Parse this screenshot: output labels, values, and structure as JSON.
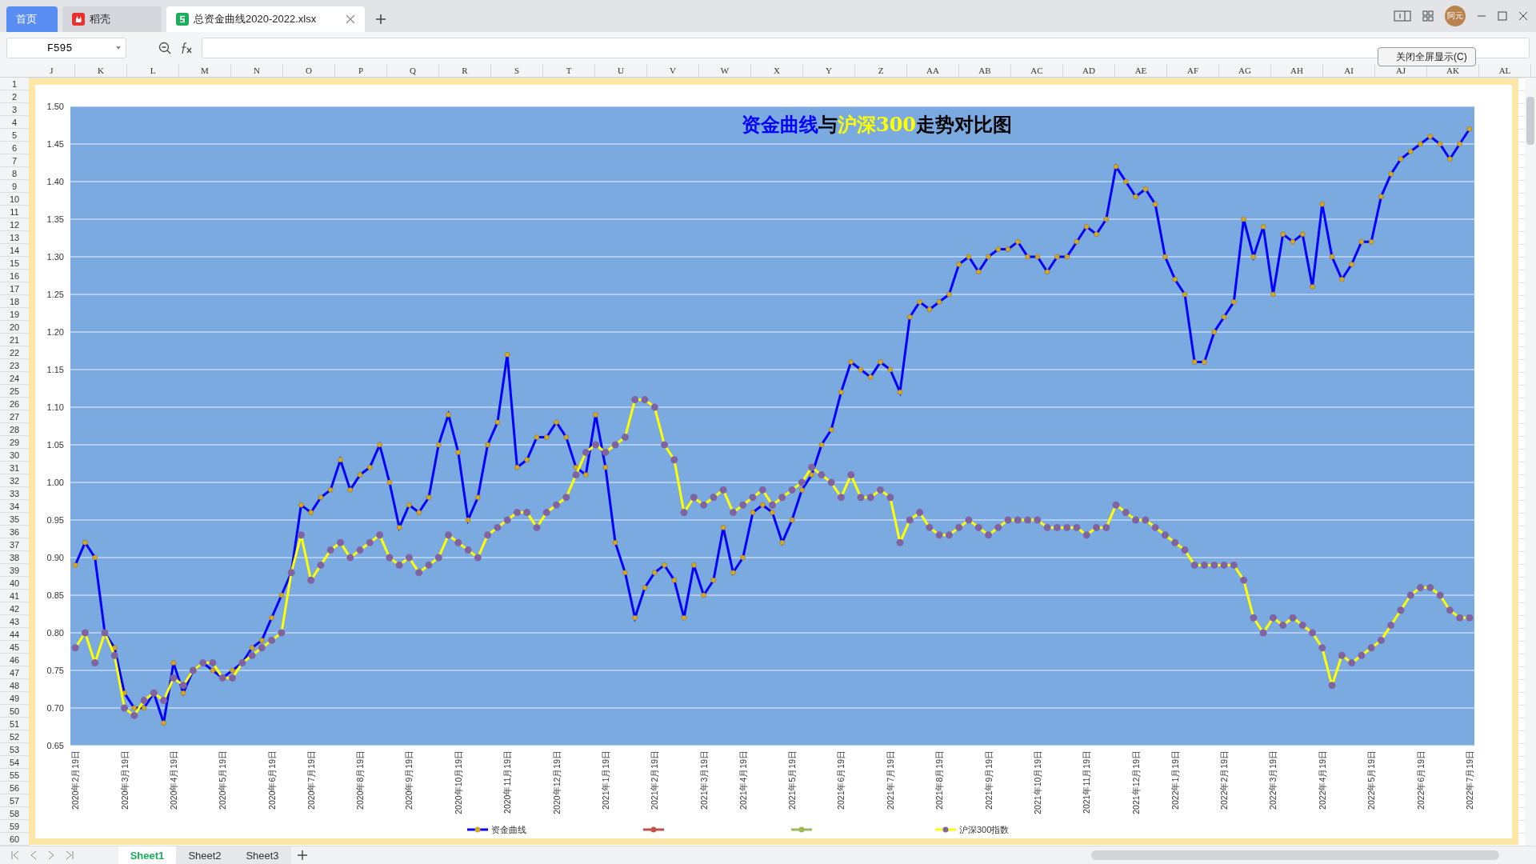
{
  "tabs": [
    {
      "label": "首页",
      "kind": "home",
      "selected": false
    },
    {
      "label": "稻壳",
      "kind": "docer",
      "selected": false
    },
    {
      "label": "总资金曲线2020-2022.xlsx",
      "kind": "sheet",
      "selected": true
    }
  ],
  "user": {
    "avatar_text": "阿元"
  },
  "formula_bar": {
    "cell_ref": "F595"
  },
  "columns": [
    "J",
    "K",
    "L",
    "M",
    "N",
    "O",
    "P",
    "Q",
    "R",
    "S",
    "T",
    "U",
    "V",
    "W",
    "X",
    "Y",
    "Z",
    "AA",
    "AB",
    "AC",
    "AD",
    "AE",
    "AF",
    "AG",
    "AH",
    "AI",
    "AJ",
    "AK",
    "AL"
  ],
  "rows": [
    "1",
    "2",
    "3",
    "4",
    "5",
    "6",
    "7",
    "8",
    "9",
    "10",
    "11",
    "12",
    "13",
    "14",
    "15",
    "16",
    "17",
    "18",
    "19",
    "20",
    "21",
    "22",
    "23",
    "24",
    "25",
    "26",
    "27",
    "28",
    "29",
    "30",
    "31",
    "32",
    "33",
    "34",
    "35",
    "36",
    "37",
    "38",
    "39",
    "40",
    "41",
    "42",
    "43",
    "44",
    "45",
    "46",
    "47",
    "48",
    "49",
    "50",
    "51",
    "52",
    "53",
    "54",
    "55",
    "56",
    "57",
    "58",
    "59",
    "60"
  ],
  "fullscreen_button": "关闭全屏显示(C)",
  "chart": {
    "title_parts": [
      {
        "text": "资金曲线",
        "color": "#0000ff"
      },
      {
        "text": "与",
        "color": "#000000"
      },
      {
        "text": "沪深300",
        "color": "#ffff00"
      },
      {
        "text": "走势对比图",
        "color": "#000000"
      }
    ],
    "chart_data": {
      "type": "line",
      "ylim": [
        0.65,
        1.5
      ],
      "grid": true,
      "legend": true,
      "categories": [
        "2020年2月19日",
        null,
        null,
        null,
        null,
        "2020年3月19日",
        null,
        null,
        null,
        null,
        "2020年4月19日",
        null,
        null,
        null,
        null,
        "2020年5月19日",
        null,
        null,
        null,
        null,
        "2020年6月19日",
        null,
        null,
        null,
        "2020年7月19日",
        null,
        null,
        null,
        null,
        "2020年8月19日",
        null,
        null,
        null,
        null,
        "2020年9月19日",
        null,
        null,
        null,
        null,
        "2020年10月19日",
        null,
        null,
        null,
        null,
        "2020年11月19日",
        null,
        null,
        null,
        null,
        "2020年12月19日",
        null,
        null,
        null,
        null,
        "2021年1月19日",
        null,
        null,
        null,
        null,
        "2021年2月19日",
        null,
        null,
        null,
        null,
        "2021年3月19日",
        null,
        null,
        null,
        "2021年4月19日",
        null,
        null,
        null,
        null,
        "2021年5月19日",
        null,
        null,
        null,
        null,
        "2021年6月19日",
        null,
        null,
        null,
        null,
        "2021年7月19日",
        null,
        null,
        null,
        null,
        "2021年8月19日",
        null,
        null,
        null,
        null,
        "2021年9月19日",
        null,
        null,
        null,
        null,
        "2021年10月19日",
        null,
        null,
        null,
        null,
        "2021年11月19日",
        null,
        null,
        null,
        null,
        "2021年12月19日",
        null,
        null,
        null,
        "2022年1月19日",
        null,
        null,
        null,
        null,
        "2022年2月19日",
        null,
        null,
        null,
        null,
        "2022年3月19日",
        null,
        null,
        null,
        null,
        "2022年4月19日",
        null,
        null,
        null,
        null,
        "2022年5月19日",
        null,
        null,
        null,
        null,
        "2022年6月19日",
        null,
        null,
        null,
        null,
        "2022年7月19日"
      ],
      "yticks": [
        {
          "value": 0.65,
          "label": "0.65"
        },
        {
          "value": 0.7,
          "label": "0.70"
        },
        {
          "value": 0.75,
          "label": "0.75"
        },
        {
          "value": 0.8,
          "label": "0.80"
        },
        {
          "value": 0.85,
          "label": "0.85"
        },
        {
          "value": 0.9,
          "label": "0.90"
        },
        {
          "value": 0.95,
          "label": "0.95"
        },
        {
          "value": 1.0,
          "label": "1.00"
        },
        {
          "value": 1.05,
          "label": "1.05"
        },
        {
          "value": 1.1,
          "label": "1.10"
        },
        {
          "value": 1.15,
          "label": "1.15"
        },
        {
          "value": 1.2,
          "label": "1.20"
        },
        {
          "value": 1.25,
          "label": "1.25"
        },
        {
          "value": 1.3,
          "label": "1.30"
        },
        {
          "value": 1.35,
          "label": "1.35"
        },
        {
          "value": 1.4,
          "label": "1.40"
        },
        {
          "value": 1.45,
          "label": "1.45"
        },
        {
          "value": 1.5,
          "label": "1.50"
        }
      ],
      "series": [
        {
          "name": "资金曲线",
          "color": "#0000ff",
          "marker": {
            "shape": "circle",
            "color": "#d4a82a"
          },
          "values": [
            0.89,
            0.92,
            0.9,
            0.8,
            0.78,
            0.72,
            0.7,
            0.7,
            0.72,
            0.68,
            0.76,
            0.72,
            0.75,
            0.76,
            0.75,
            0.74,
            0.75,
            0.76,
            0.78,
            0.79,
            0.82,
            0.85,
            0.88,
            0.97,
            0.96,
            0.98,
            0.99,
            1.03,
            0.99,
            1.01,
            1.02,
            1.05,
            1.0,
            0.94,
            0.97,
            0.96,
            0.98,
            1.05,
            1.09,
            1.04,
            0.95,
            0.98,
            1.05,
            1.08,
            1.17,
            1.02,
            1.03,
            1.06,
            1.06,
            1.08,
            1.06,
            1.02,
            1.01,
            1.09,
            1.02,
            0.92,
            0.88,
            0.82,
            0.86,
            0.88,
            0.89,
            0.87,
            0.82,
            0.89,
            0.85,
            0.87,
            0.94,
            0.88,
            0.9,
            0.96,
            0.97,
            0.96,
            0.92,
            0.95,
            0.99,
            1.01,
            1.05,
            1.07,
            1.12,
            1.16,
            1.15,
            1.14,
            1.16,
            1.15,
            1.12,
            1.22,
            1.24,
            1.23,
            1.24,
            1.25,
            1.29,
            1.3,
            1.28,
            1.3,
            1.31,
            1.31,
            1.32,
            1.3,
            1.3,
            1.28,
            1.3,
            1.3,
            1.32,
            1.34,
            1.33,
            1.35,
            1.42,
            1.4,
            1.38,
            1.39,
            1.37,
            1.3,
            1.27,
            1.25,
            1.16,
            1.16,
            1.2,
            1.22,
            1.24,
            1.35,
            1.3,
            1.34,
            1.25,
            1.33,
            1.32,
            1.33,
            1.26,
            1.37,
            1.3,
            1.27,
            1.29,
            1.32,
            1.32,
            1.38,
            1.41,
            1.43,
            1.44,
            1.45,
            1.46,
            1.45,
            1.43,
            1.45,
            1.47
          ]
        },
        {
          "color": "#c0504d",
          "marker": {
            "shape": "circle",
            "color": "#c0504d"
          },
          "values": [
            null,
            null,
            null,
            null,
            null,
            null,
            null,
            null,
            null,
            null,
            null,
            null,
            null,
            null,
            null,
            null,
            null,
            null,
            null,
            null,
            null,
            null,
            null,
            null,
            null,
            null,
            null,
            null,
            null,
            null,
            null,
            null,
            null,
            null,
            null,
            null,
            null,
            null,
            null,
            null,
            null,
            null,
            null,
            null,
            null,
            null,
            null,
            null,
            null,
            null,
            null,
            null,
            null,
            null,
            null,
            null,
            null,
            null,
            null,
            null,
            null,
            null,
            null,
            null,
            null,
            null,
            null,
            null,
            null,
            null,
            null,
            null,
            null,
            null,
            null,
            null,
            null,
            null,
            null,
            null,
            null,
            null,
            null,
            null,
            null,
            null,
            null,
            null,
            null,
            null,
            null,
            null,
            null,
            null,
            null,
            null,
            null,
            null,
            null,
            null,
            null,
            null,
            null,
            null,
            null,
            null,
            null,
            null,
            null,
            null,
            null,
            null,
            null,
            null,
            null,
            null,
            null,
            null,
            null,
            null,
            null,
            null,
            null,
            null,
            null,
            null,
            null,
            null,
            null,
            null,
            null,
            null,
            null,
            null,
            null,
            null,
            null,
            null,
            null,
            null,
            null,
            null,
            null
          ]
        },
        {
          "color": "#9bbb59",
          "marker": {
            "shape": "circle",
            "color": "#9bbb59"
          },
          "values": [
            null,
            null,
            null,
            null,
            null,
            null,
            null,
            null,
            null,
            null,
            null,
            null,
            null,
            null,
            null,
            null,
            null,
            null,
            null,
            null,
            null,
            null,
            null,
            null,
            null,
            null,
            null,
            null,
            null,
            null,
            null,
            null,
            null,
            null,
            null,
            null,
            null,
            null,
            null,
            null,
            null,
            null,
            null,
            null,
            null,
            null,
            null,
            null,
            null,
            null,
            null,
            null,
            null,
            null,
            null,
            null,
            null,
            null,
            null,
            null,
            null,
            null,
            null,
            null,
            null,
            null,
            null,
            null,
            null,
            null,
            null,
            null,
            null,
            null,
            null,
            null,
            null,
            null,
            null,
            null,
            null,
            null,
            null,
            null,
            null,
            null,
            null,
            null,
            null,
            null,
            null,
            null,
            null,
            null,
            null,
            null,
            null,
            null,
            null,
            null,
            null,
            null,
            null,
            null,
            null,
            null,
            null,
            null,
            null,
            null,
            null,
            null,
            null,
            null,
            null,
            null,
            null,
            null,
            null,
            null,
            null,
            null,
            null,
            null,
            null,
            null,
            null,
            null,
            null,
            null,
            null,
            null,
            null,
            null,
            null,
            null,
            null,
            null,
            null,
            null,
            null,
            null,
            null
          ]
        },
        {
          "name": "沪深300指数",
          "color": "#ffff00",
          "marker": {
            "shape": "circle",
            "color": "#8064a2"
          },
          "values": [
            0.78,
            0.8,
            0.76,
            0.8,
            0.77,
            0.7,
            0.69,
            0.71,
            0.72,
            0.71,
            0.74,
            0.73,
            0.75,
            0.76,
            0.76,
            0.74,
            0.74,
            0.76,
            0.77,
            0.78,
            0.79,
            0.8,
            0.88,
            0.93,
            0.87,
            0.89,
            0.91,
            0.92,
            0.9,
            0.91,
            0.92,
            0.93,
            0.9,
            0.89,
            0.9,
            0.88,
            0.89,
            0.9,
            0.93,
            0.92,
            0.91,
            0.9,
            0.93,
            0.94,
            0.95,
            0.96,
            0.96,
            0.94,
            0.96,
            0.97,
            0.98,
            1.01,
            1.04,
            1.05,
            1.04,
            1.05,
            1.06,
            1.11,
            1.11,
            1.1,
            1.05,
            1.03,
            0.96,
            0.98,
            0.97,
            0.98,
            0.99,
            0.96,
            0.97,
            0.98,
            0.99,
            0.97,
            0.98,
            0.99,
            1.0,
            1.02,
            1.01,
            1.0,
            0.98,
            1.01,
            0.98,
            0.98,
            0.99,
            0.98,
            0.92,
            0.95,
            0.96,
            0.94,
            0.93,
            0.93,
            0.94,
            0.95,
            0.94,
            0.93,
            0.94,
            0.95,
            0.95,
            0.95,
            0.95,
            0.94,
            0.94,
            0.94,
            0.94,
            0.93,
            0.94,
            0.94,
            0.97,
            0.96,
            0.95,
            0.95,
            0.94,
            0.93,
            0.92,
            0.91,
            0.89,
            0.89,
            0.89,
            0.89,
            0.89,
            0.87,
            0.82,
            0.8,
            0.82,
            0.81,
            0.82,
            0.81,
            0.8,
            0.78,
            0.73,
            0.77,
            0.76,
            0.77,
            0.78,
            0.79,
            0.81,
            0.83,
            0.85,
            0.86,
            0.86,
            0.85,
            0.83,
            0.82,
            0.82
          ]
        }
      ]
    }
  },
  "sheets": [
    {
      "label": "Sheet1",
      "selected": true
    },
    {
      "label": "Sheet2",
      "selected": false
    },
    {
      "label": "Sheet3",
      "selected": false
    }
  ]
}
